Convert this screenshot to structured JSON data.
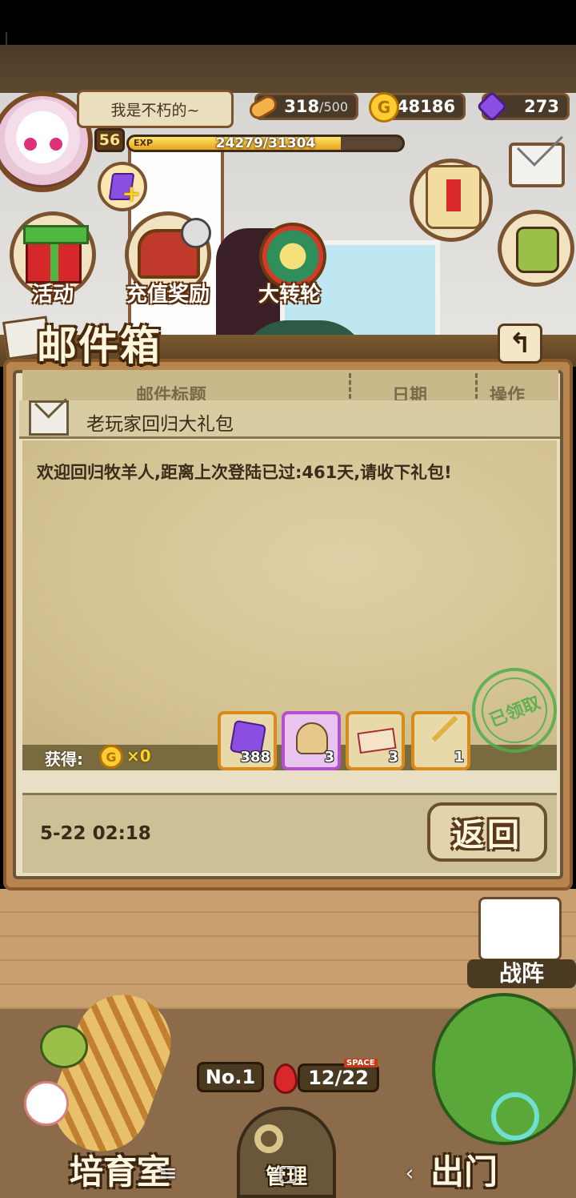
{
  "player": {
    "name": "我是不朽的~",
    "level": "56",
    "exp_tag": "EXP",
    "exp_text": "24279/31304",
    "exp_fraction": 0.7756
  },
  "resources": {
    "stamina_current": "318",
    "stamina_max": "/500",
    "gold": "48186",
    "gems": "273"
  },
  "menu": {
    "activity_label": "活动",
    "recharge_label": "充值奖励",
    "wheel_label": "大转轮"
  },
  "mailbox": {
    "title": "邮件箱",
    "back_icon": "↰",
    "col_title": "邮件标题",
    "col_date": "日期",
    "col_action": "操作",
    "mail_title": "老玩家回归大礼包",
    "mail_text": "欢迎回归牧羊人,距离上次登陆已过:461天,请收下礼包!",
    "obtain_label": "获得:",
    "coin_icon": "G",
    "coin_amount": "×0",
    "items": [
      {
        "icon": "purple-gem-icon",
        "count": "388"
      },
      {
        "icon": "helmet-icon",
        "count": "3"
      },
      {
        "icon": "ticket-icon",
        "count": "3"
      },
      {
        "icon": "key-icon",
        "count": "1"
      }
    ],
    "stamp_text": "已领取",
    "date": "5-22 02:18",
    "return_label": "返回"
  },
  "bottom": {
    "formation_label": "战阵",
    "rank": "No.1",
    "space": "12/22",
    "space_tag": "SPACE",
    "nursery_label": "培育室",
    "manage_label": "管理",
    "exit_label": "出门"
  },
  "nav": {
    "menu_icon": "≡",
    "home_icon": "▢",
    "back_icon": "‹"
  },
  "colors": {
    "panel_border": "#8a5a2a",
    "item_orange": "#d88a1a",
    "item_purple": "#b54fd0",
    "stamp_green": "#4fae4a"
  }
}
